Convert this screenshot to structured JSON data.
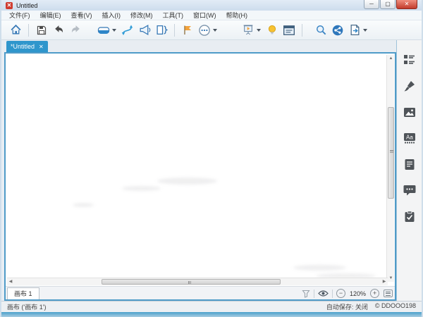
{
  "window": {
    "title": "Untitled"
  },
  "titlebar_controls": {
    "minimize": "─",
    "maximize": "▢",
    "close": "✕"
  },
  "menu": {
    "items": [
      "文件(F)",
      "编辑(E)",
      "查看(V)",
      "插入(I)",
      "修改(M)",
      "工具(T)",
      "窗口(W)",
      "帮助(H)"
    ]
  },
  "toolbar": {
    "buttons": [
      "home",
      "save",
      "undo",
      "redo",
      "topic",
      "relationship",
      "callout",
      "summary",
      "flag-marker",
      "more-markers",
      "presentation",
      "brainstorming",
      "notes-window",
      "search",
      "share",
      "export"
    ]
  },
  "doc_tab": {
    "label": "*Untitled",
    "close_glyph": "✕"
  },
  "canvas_tabbar": {
    "tab_label": "画布 1",
    "zoom_out_glyph": "−",
    "zoom_level": "120%",
    "zoom_in_glyph": "+"
  },
  "statusbar": {
    "left": "画布 ('画布 1')",
    "autosave": "自动保存: 关闭",
    "copyright": "© DDOOO198"
  },
  "sidebar": {
    "icons": [
      "outline",
      "format-brush",
      "picture",
      "font",
      "note",
      "comment",
      "task"
    ]
  },
  "colors": {
    "accent": "#2f96cc",
    "canvas_border": "#4f9bc8",
    "close_red": "#c23b2c",
    "flag_orange": "#f2a33c",
    "bulb_yellow": "#f7c231",
    "logo_red": "#cf3b2f"
  }
}
